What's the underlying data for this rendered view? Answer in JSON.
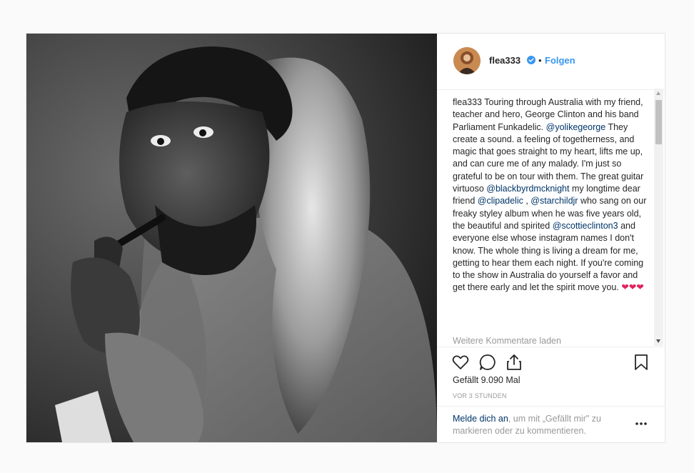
{
  "header": {
    "username": "flea333",
    "separator": "•",
    "follow_label": "Folgen"
  },
  "caption": {
    "username": "flea333",
    "text_1": " Touring through Australia with my friend, teacher and hero, George Clinton and his band Parliament Funkadelic. ",
    "mention_1": "@yolikegeorge",
    "text_2": " They create a sound. a feeling of togetherness, and magic that goes straight to my heart, lifts me up, and can cure me of any malady. I'm just so grateful to be on tour with them. The great guitar virtuoso ",
    "mention_2": "@blackbyrdmcknight",
    "text_3": " my longtime dear friend ",
    "mention_3": "@clipadelic",
    "text_4": " , ",
    "mention_4": "@starchildjr",
    "text_5": " who sang on our freaky styley album when he was five years old, the beautiful and spirited ",
    "mention_5": "@scottieclinton3",
    "text_6": " and everyone else whose instagram names I don't know. The whole thing is living a dream for me, getting to hear them each night. If you're coming to the show in Australia do yourself a favor and get there early and let the spirit move you. ",
    "emoji": "❤❤❤"
  },
  "load_more_label": "Weitere Kommentare laden",
  "likes_label": "Gefällt 9.090 Mal",
  "time_label": "VOR 3 STUNDEN",
  "login": {
    "link_label": "Melde dich an",
    "rest": ", um mit „Gefällt mir\" zu markieren oder zu kommentieren."
  },
  "icons": {
    "like": "heart-icon",
    "comment": "comment-icon",
    "share": "share-icon",
    "save": "bookmark-icon",
    "more": "more-options-icon",
    "verified": "verified-badge-icon"
  },
  "colors": {
    "link_blue": "#3897f0",
    "mention_blue": "#003569",
    "muted_text": "#999999",
    "heart_red": "#e0245e"
  }
}
